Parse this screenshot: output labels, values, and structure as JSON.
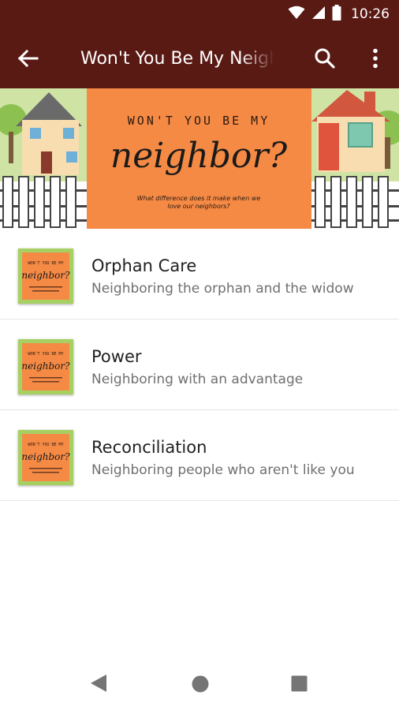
{
  "status_bar": {
    "time": "10:26"
  },
  "app_bar": {
    "title": "Won't You Be My Neighbor?"
  },
  "banner": {
    "line1": "WON'T YOU BE MY",
    "line2": "neighbor?",
    "caption1": "What difference does it make when we",
    "caption2": "love our neighbors?"
  },
  "thumb_text": {
    "line1": "WON'T YOU BE MY",
    "line2": "neighbor?"
  },
  "items": [
    {
      "title": "Orphan Care",
      "subtitle": "Neighboring the orphan and the widow"
    },
    {
      "title": "Power",
      "subtitle": "Neighboring with an advantage"
    },
    {
      "title": "Reconciliation",
      "subtitle": "Neighboring people who aren't like you"
    }
  ],
  "colors": {
    "primary": "#5a1a14",
    "banner_orange": "#f58a45",
    "banner_green": "#cfe3a4"
  }
}
